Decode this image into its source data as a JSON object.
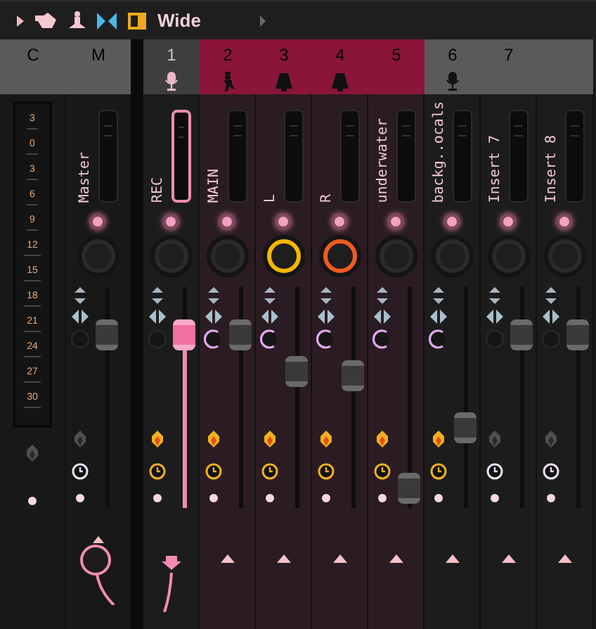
{
  "toolbar": {
    "mode": "Wide"
  },
  "header": {
    "scale_label": "C",
    "master_label": "M"
  },
  "scale": [
    "3",
    "0",
    "3",
    "6",
    "9",
    "12",
    "15",
    "18",
    "21",
    "24",
    "27",
    "30"
  ],
  "master": {
    "name": "Master",
    "level": 0.83
  },
  "channels": [
    {
      "number": "1",
      "name": "REC",
      "kind": "mic",
      "selected": false,
      "record": true,
      "armed": true,
      "pan_set": false,
      "level": 0.83
    },
    {
      "number": "2",
      "name": "MAIN",
      "kind": "figure",
      "selected": true,
      "record": false,
      "armed": true,
      "pan_set": true,
      "level": 0.83
    },
    {
      "number": "3",
      "name": "L",
      "kind": "bell",
      "selected": true,
      "record": false,
      "armed": true,
      "pan_set": true,
      "color": "#f5b800",
      "level": 0.64
    },
    {
      "number": "4",
      "name": "R",
      "kind": "bell",
      "selected": true,
      "record": false,
      "armed": true,
      "pan_set": true,
      "color": "#f05a1e",
      "level": 0.62
    },
    {
      "number": "5",
      "name": "underwater",
      "kind": "plain",
      "selected": true,
      "record": false,
      "armed": true,
      "pan_set": true,
      "level": 0.04
    },
    {
      "number": "6",
      "name": "backg..ocals",
      "kind": "mic",
      "selected": false,
      "record": false,
      "armed": true,
      "pan_set": true,
      "level": 0.35
    },
    {
      "number": "7",
      "name": "Insert 7",
      "kind": "plain",
      "selected": false,
      "record": false,
      "armed": false,
      "pan_set": false,
      "level": 0.83
    },
    {
      "name": "Insert 8",
      "kind": "plain",
      "selected": false,
      "record": false,
      "armed": false,
      "pan_set": false,
      "level": 0.83
    }
  ]
}
